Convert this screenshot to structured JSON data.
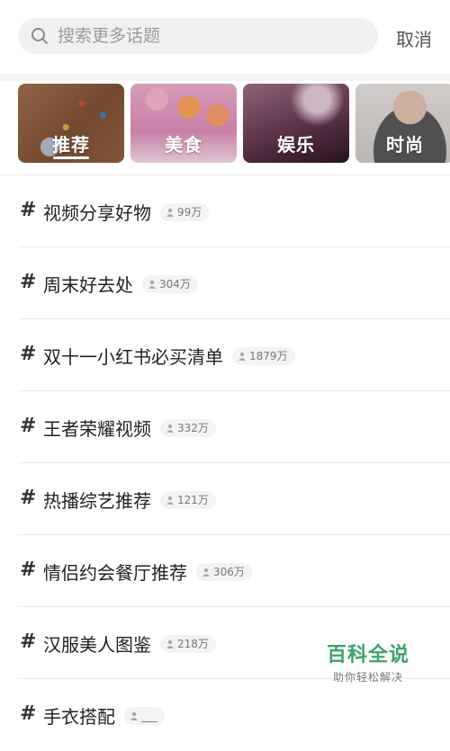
{
  "search": {
    "placeholder": "搜索更多话题",
    "cancel_label": "取消"
  },
  "categories": [
    {
      "label": "推荐",
      "selected": true
    },
    {
      "label": "美食",
      "selected": false
    },
    {
      "label": "娱乐",
      "selected": false
    },
    {
      "label": "时尚",
      "selected": false
    }
  ],
  "topics": [
    {
      "title": "视频分享好物",
      "count": "99万"
    },
    {
      "title": "周末好去处",
      "count": "304万"
    },
    {
      "title": "双十一小红书必买清单",
      "count": "1879万"
    },
    {
      "title": "王者荣耀视频",
      "count": "332万"
    },
    {
      "title": "热播综艺推荐",
      "count": "121万"
    },
    {
      "title": "情侣约会餐厅推荐",
      "count": "306万"
    },
    {
      "title": "汉服美人图鉴",
      "count": "218万"
    },
    {
      "title": "手衣搭配",
      "count": "___"
    }
  ],
  "topic_prefix": "#",
  "watermark": {
    "title": "百科全说",
    "subtitle": "助你轻松解决"
  },
  "icons": {
    "search": "search-icon",
    "person": "person-icon"
  }
}
